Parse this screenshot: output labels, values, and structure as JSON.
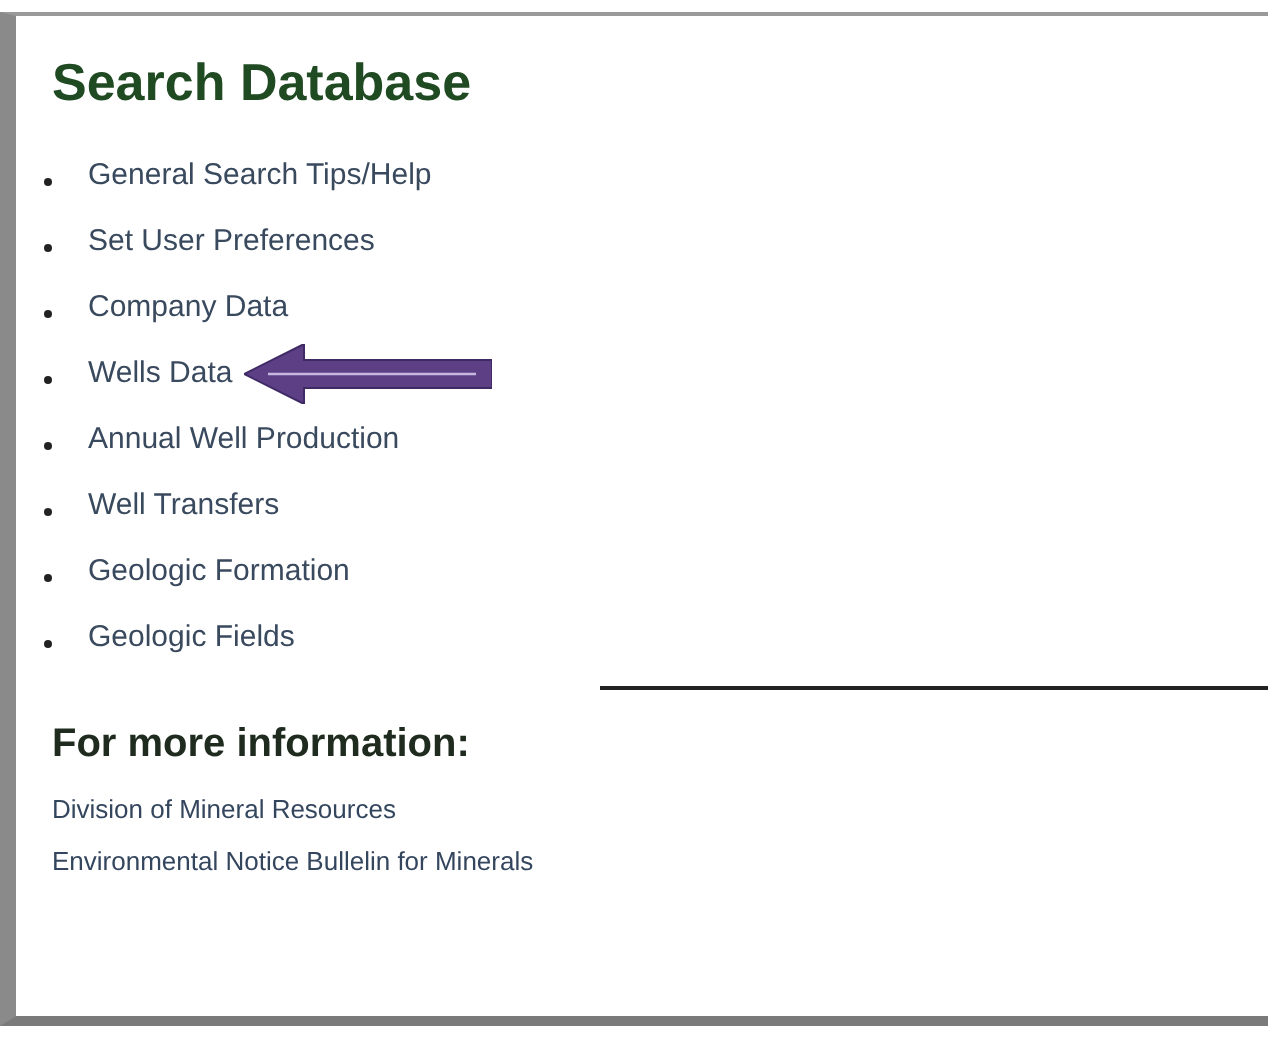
{
  "title": "Search Database",
  "links": [
    {
      "label": "General Search Tips/Help",
      "pointed": false
    },
    {
      "label": "Set User Preferences",
      "pointed": false
    },
    {
      "label": "Company Data",
      "pointed": false
    },
    {
      "label": "Wells Data",
      "pointed": true
    },
    {
      "label": "Annual Well Production",
      "pointed": false
    },
    {
      "label": "Well Transfers",
      "pointed": false
    },
    {
      "label": "Geologic Formation",
      "pointed": false
    },
    {
      "label": "Geologic Fields",
      "pointed": false
    }
  ],
  "more_info": {
    "heading": "For more information:",
    "links": [
      "Division of Mineral Resources",
      "Environmental Notice Bullelin for Minerals"
    ]
  }
}
